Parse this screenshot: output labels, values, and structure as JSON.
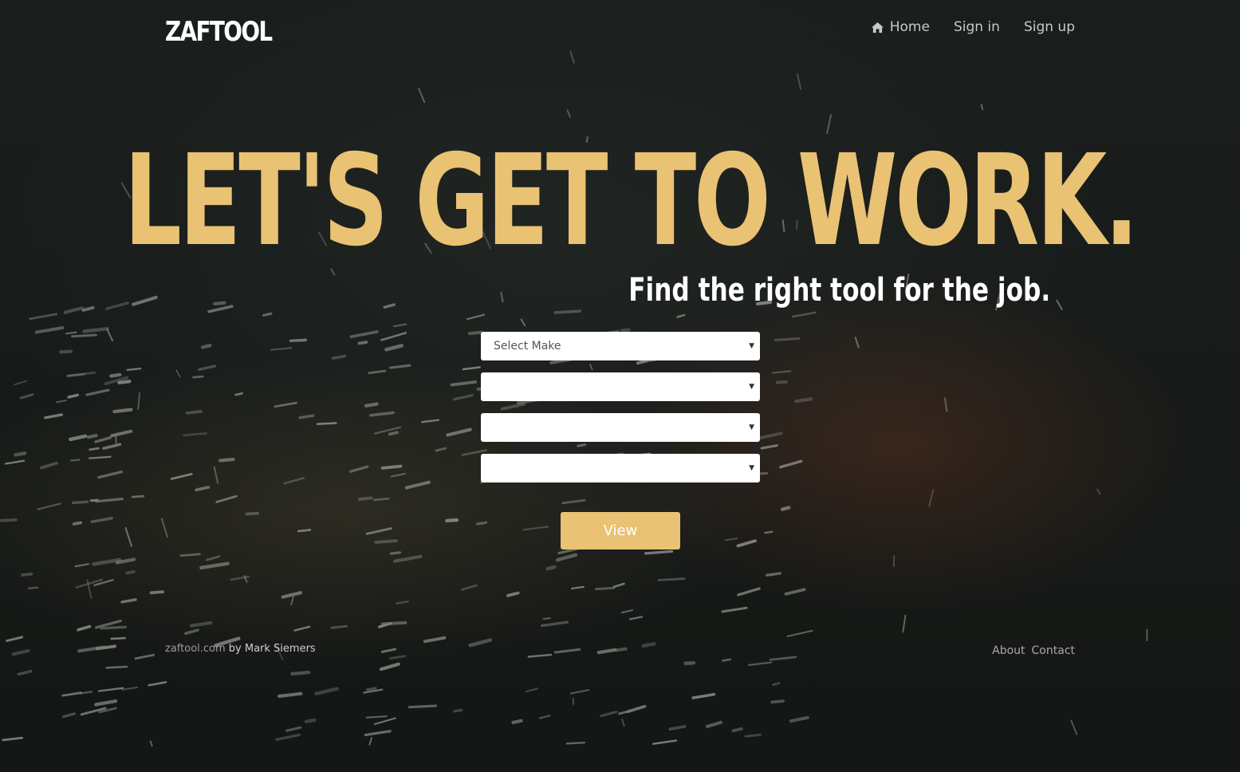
{
  "navbar": {
    "brand": "ZAFTOOL",
    "links": [
      {
        "label": "Home",
        "icon": "home-icon"
      },
      {
        "label": "Sign in"
      },
      {
        "label": "Sign up"
      }
    ]
  },
  "hero": {
    "title": "LET'S GET TO WORK.",
    "subtitle": "Find the right tool for the job."
  },
  "form": {
    "selects": [
      {
        "value": "Select Make"
      },
      {
        "value": ""
      },
      {
        "value": ""
      },
      {
        "value": ""
      }
    ],
    "button_label": "View"
  },
  "footer": {
    "site": "zaftool.com",
    "byline": " by Mark Siemers",
    "links": [
      "About",
      "Contact"
    ]
  },
  "colors": {
    "accent": "#e9c273",
    "background": "#1c1f1e"
  }
}
